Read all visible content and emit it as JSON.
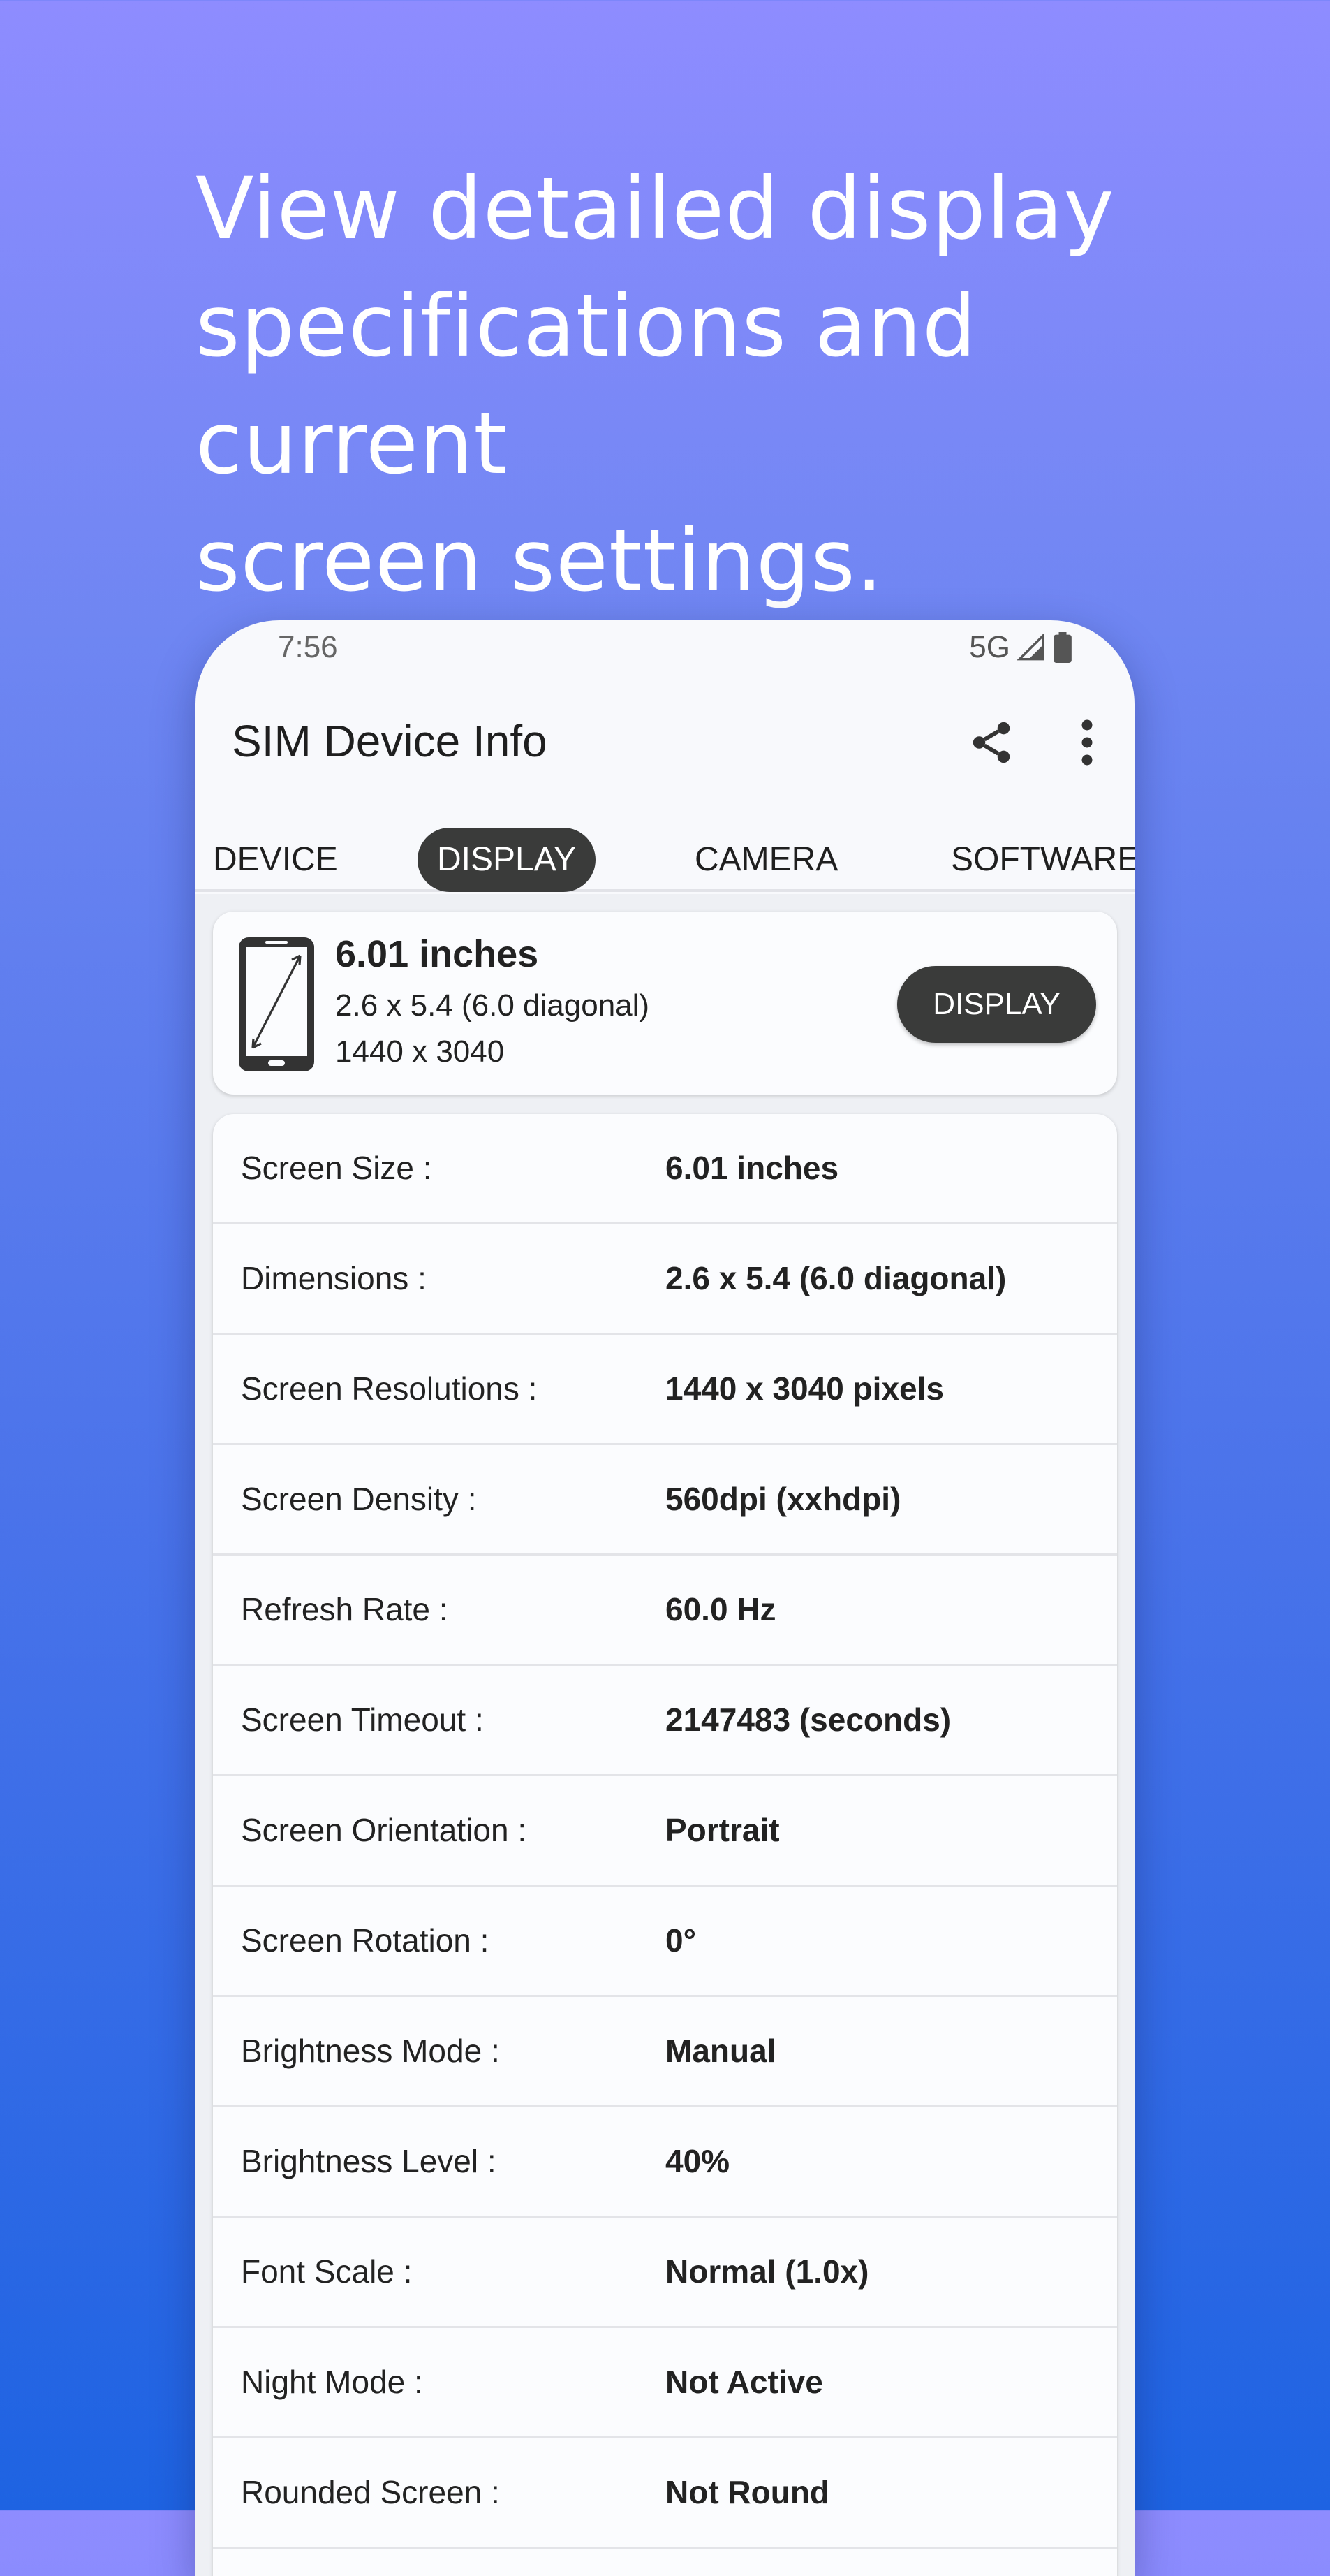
{
  "headline": {
    "line1": "View detailed display",
    "line2": "specifications and current",
    "line3": "screen settings."
  },
  "status": {
    "time": "7:56",
    "network": "5G",
    "icons": [
      "signal-icon",
      "battery-icon"
    ]
  },
  "appbar": {
    "title": "SIM Device Info",
    "icons": [
      "share-icon",
      "more-vert-icon"
    ]
  },
  "tabs": [
    {
      "label": "DEVICE",
      "selected": false
    },
    {
      "label": "DISPLAY",
      "selected": true
    },
    {
      "label": "CAMERA",
      "selected": false
    },
    {
      "label": "SOFTWARE",
      "selected": false
    }
  ],
  "summary": {
    "title": "6.01 inches",
    "line1": "2.6 x 5.4 (6.0 diagonal)",
    "line2": "1440 x 3040",
    "button": "DISPLAY",
    "icon": "phone-diagonal-icon"
  },
  "specs": [
    {
      "label": "Screen Size :",
      "value": "6.01 inches"
    },
    {
      "label": "Dimensions :",
      "value": "2.6 x 5.4 (6.0 diagonal)"
    },
    {
      "label": "Screen Resolutions :",
      "value": "1440 x 3040 pixels"
    },
    {
      "label": "Screen Density :",
      "value": "560dpi (xxhdpi)"
    },
    {
      "label": "Refresh Rate :",
      "value": "60.0 Hz"
    },
    {
      "label": "Screen Timeout :",
      "value": "2147483 (seconds)"
    },
    {
      "label": "Screen Orientation :",
      "value": "Portrait"
    },
    {
      "label": "Screen Rotation :",
      "value": "0°"
    },
    {
      "label": "Brightness Mode :",
      "value": "Manual"
    },
    {
      "label": "Brightness Level :",
      "value": "40%"
    },
    {
      "label": "Font Scale :",
      "value": "Normal (1.0x)"
    },
    {
      "label": "Night Mode :",
      "value": "Not Active"
    },
    {
      "label": "Rounded Screen :",
      "value": "Not Round"
    }
  ],
  "colors": {
    "gradient_top": "#8e8cff",
    "gradient_bottom": "#1e63e2",
    "selected_tab": "#3a3b3a",
    "card_bg": "#fbfcfe"
  }
}
